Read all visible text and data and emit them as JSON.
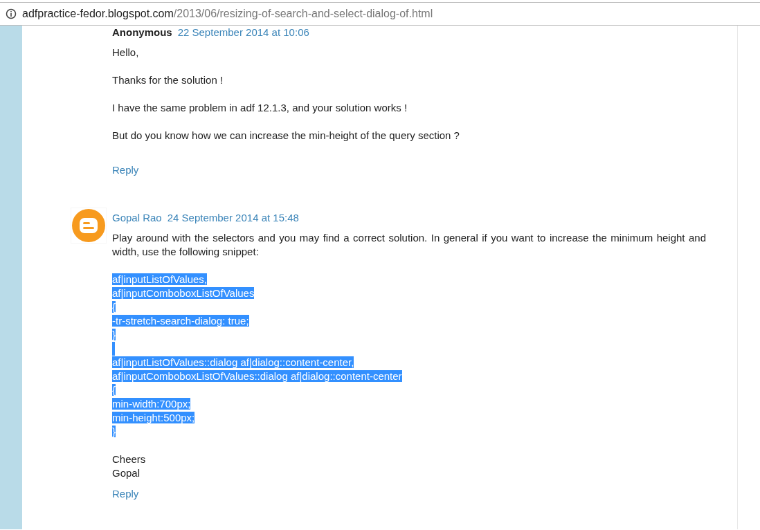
{
  "address_bar": {
    "host": "adfpractice-fedor.blogspot.com",
    "path": "/2013/06/resizing-of-search-and-select-dialog-of.html"
  },
  "comments": [
    {
      "author": "Anonymous",
      "author_is_link": false,
      "timestamp": "22 September 2014 at 10:06",
      "paragraphs": [
        "Hello,",
        "Thanks for the solution !",
        "I have the same problem in adf 12.1.3, and your solution works !",
        "But do you know how we can increase the min-height of the query section ?"
      ],
      "reply": "Reply"
    },
    {
      "author": "Gopal Rao",
      "author_is_link": true,
      "avatar": {
        "kind": "blogger"
      },
      "timestamp": "24 September 2014 at 15:48",
      "paragraphs": [
        "Play around with the selectors and you may find a correct solution. In general if you want to increase the minimum height and width, use the following snippet:"
      ],
      "snippet": {
        "selected": true,
        "blocks": [
          [
            "af|inputListOfValues,",
            "af|inputComboboxListOfValues",
            "{",
            "-tr-stretch-search-dialog: true;",
            "}"
          ],
          [
            "af|inputListOfValues::dialog af|dialog::content-center,",
            "af|inputComboboxListOfValues::dialog af|dialog::content-center",
            "{",
            "min-width:700px;",
            "min-height:500px;",
            "}"
          ]
        ]
      },
      "closing": [
        "Cheers",
        "Gopal"
      ],
      "reply": "Reply"
    }
  ]
}
